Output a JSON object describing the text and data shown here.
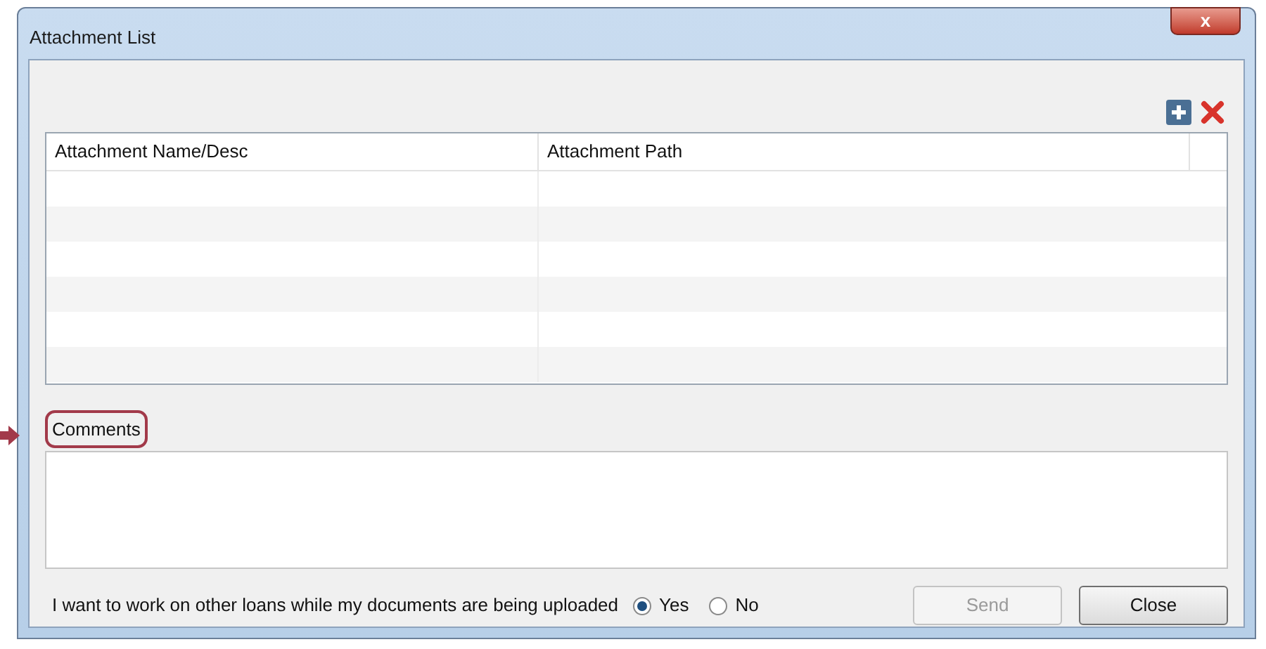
{
  "window": {
    "title": "Attachment List",
    "close_label": "x"
  },
  "table": {
    "columns": [
      "Attachment Name/Desc",
      "Attachment Path"
    ]
  },
  "comments": {
    "label": "Comments",
    "highlighted": true
  },
  "upload_option": {
    "question": "I want to work on other loans while my documents are being uploaded",
    "options": [
      {
        "label": "Yes",
        "selected": true
      },
      {
        "label": "No",
        "selected": false
      }
    ]
  },
  "buttons": [
    {
      "label": "Send",
      "disabled": true
    },
    {
      "label": "Close",
      "disabled": false
    }
  ]
}
